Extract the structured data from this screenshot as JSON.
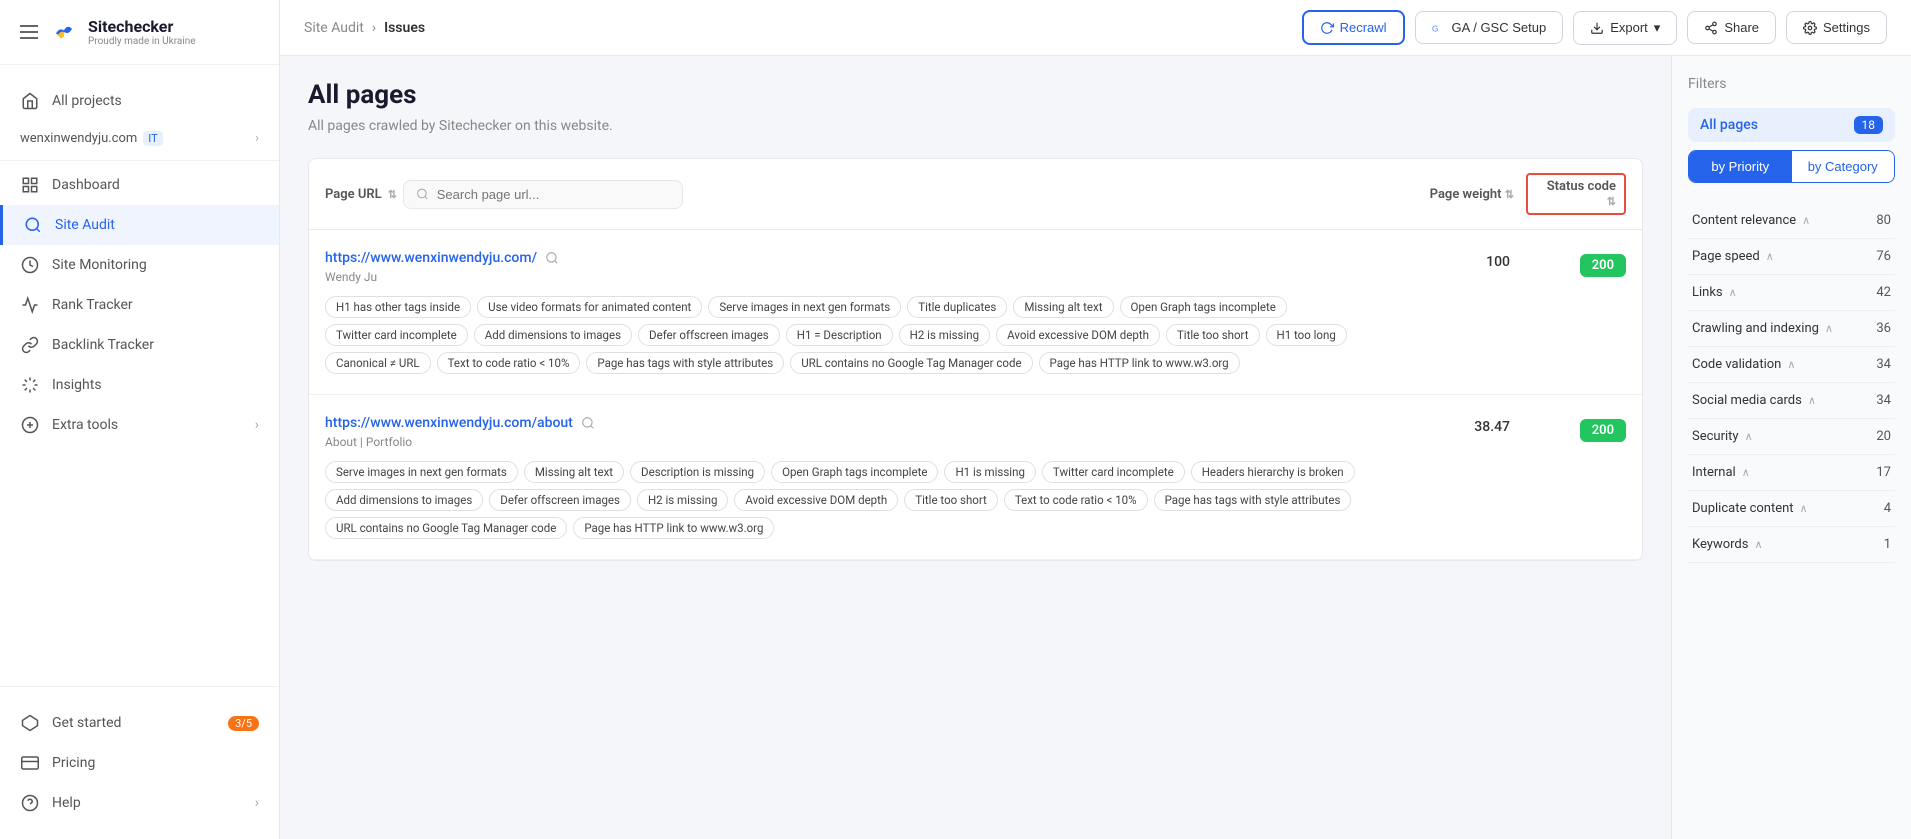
{
  "app": {
    "name": "Sitechecker",
    "tagline": "Proudly made in Ukraine"
  },
  "topbar": {
    "breadcrumb_parent": "Site Audit",
    "breadcrumb_sep": "›",
    "breadcrumb_current": "Issues",
    "btn_recrawl": "Recrawl",
    "btn_ga": "GA / GSC Setup",
    "btn_export": "Export",
    "btn_share": "Share",
    "btn_settings": "Settings"
  },
  "sidebar": {
    "nav_items": [
      {
        "label": "All projects",
        "icon": "home",
        "active": false
      },
      {
        "label": "Dashboard",
        "icon": "grid",
        "active": false
      },
      {
        "label": "Site Audit",
        "icon": "audit",
        "active": true
      },
      {
        "label": "Site Monitoring",
        "icon": "monitor",
        "active": false
      },
      {
        "label": "Rank Tracker",
        "icon": "chart",
        "active": false
      },
      {
        "label": "Backlink Tracker",
        "icon": "link",
        "active": false
      },
      {
        "label": "Insights",
        "icon": "bulb",
        "active": false
      },
      {
        "label": "Extra tools",
        "icon": "plus",
        "active": false,
        "arrow": true
      }
    ],
    "project_name": "wenxinwendyju.com",
    "project_badge": "IT",
    "bottom_items": [
      {
        "label": "Get started",
        "badge": "3/5"
      },
      {
        "label": "Pricing"
      },
      {
        "label": "Help",
        "arrow": true
      }
    ]
  },
  "page": {
    "title": "All pages",
    "subtitle": "All pages crawled by Sitechecker on this website.",
    "search_placeholder": "Search page url...",
    "col_url": "Page URL",
    "col_weight": "Page weight",
    "col_status": "Status code"
  },
  "rows": [
    {
      "url": "https://www.wenxinwendyju.com/",
      "name": "Wendy Ju",
      "weight": "100",
      "status": "200",
      "tags": [
        "H1 has other tags inside",
        "Use video formats for animated content",
        "Serve images in next gen formats",
        "Title duplicates",
        "Missing alt text",
        "Open Graph tags incomplete",
        "Twitter card incomplete",
        "Add dimensions to images",
        "Defer offscreen images",
        "H1 = Description",
        "H2 is missing",
        "Avoid excessive DOM depth",
        "Title too short",
        "H1 too long",
        "Canonical ≠ URL",
        "Text to code ratio < 10%",
        "Page has tags with style attributes",
        "URL contains no Google Tag Manager code",
        "Page has HTTP link to www.w3.org"
      ]
    },
    {
      "url": "https://www.wenxinwendyju.com/about",
      "name": "About | Portfolio",
      "weight": "38.47",
      "status": "200",
      "tags": [
        "Serve images in next gen formats",
        "Missing alt text",
        "Description is missing",
        "Open Graph tags incomplete",
        "H1 is missing",
        "Twitter card incomplete",
        "Headers hierarchy is broken",
        "Add dimensions to images",
        "Defer offscreen images",
        "H2 is missing",
        "Avoid excessive DOM depth",
        "Title too short",
        "Text to code ratio < 10%",
        "Page has tags with style attributes",
        "URL contains no Google Tag Manager code",
        "Page has HTTP link to www.w3.org"
      ]
    }
  ],
  "right_panel": {
    "title": "Filters",
    "all_pages_label": "All pages",
    "all_pages_count": "18",
    "filter_btn1": "by Priority",
    "filter_btn2": "by Category",
    "categories": [
      {
        "label": "Content relevance",
        "count": "80"
      },
      {
        "label": "Page speed",
        "count": "76"
      },
      {
        "label": "Links",
        "count": "42"
      },
      {
        "label": "Crawling and indexing",
        "count": "36"
      },
      {
        "label": "Code validation",
        "count": "34"
      },
      {
        "label": "Social media cards",
        "count": "34"
      },
      {
        "label": "Security",
        "count": "20"
      },
      {
        "label": "Internal",
        "count": "17"
      },
      {
        "label": "Duplicate content",
        "count": "4"
      },
      {
        "label": "Keywords",
        "count": "1"
      }
    ]
  }
}
